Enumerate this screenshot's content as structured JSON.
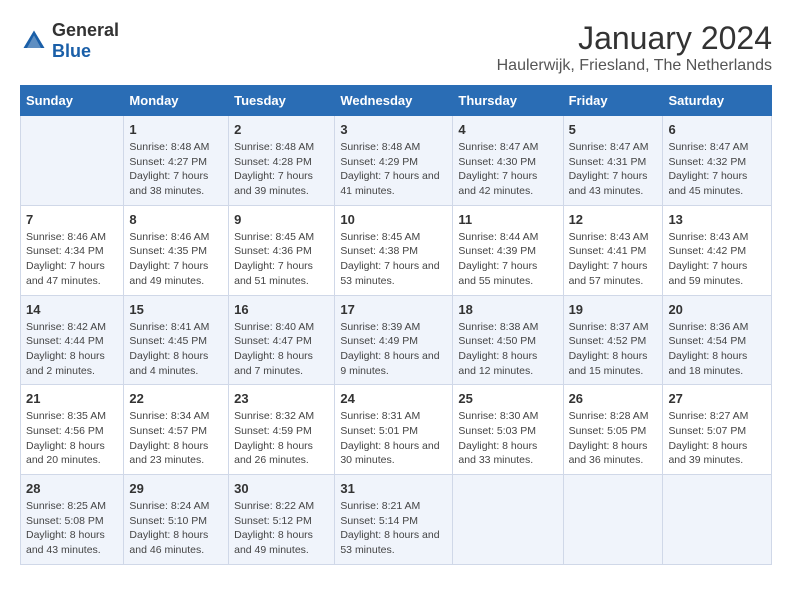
{
  "header": {
    "logo": {
      "text_general": "General",
      "text_blue": "Blue"
    },
    "title": "January 2024",
    "subtitle": "Haulerwijk, Friesland, The Netherlands"
  },
  "columns": [
    "Sunday",
    "Monday",
    "Tuesday",
    "Wednesday",
    "Thursday",
    "Friday",
    "Saturday"
  ],
  "weeks": [
    [
      {
        "day": "",
        "sunrise": "",
        "sunset": "",
        "daylight": ""
      },
      {
        "day": "1",
        "sunrise": "Sunrise: 8:48 AM",
        "sunset": "Sunset: 4:27 PM",
        "daylight": "Daylight: 7 hours and 38 minutes."
      },
      {
        "day": "2",
        "sunrise": "Sunrise: 8:48 AM",
        "sunset": "Sunset: 4:28 PM",
        "daylight": "Daylight: 7 hours and 39 minutes."
      },
      {
        "day": "3",
        "sunrise": "Sunrise: 8:48 AM",
        "sunset": "Sunset: 4:29 PM",
        "daylight": "Daylight: 7 hours and 41 minutes."
      },
      {
        "day": "4",
        "sunrise": "Sunrise: 8:47 AM",
        "sunset": "Sunset: 4:30 PM",
        "daylight": "Daylight: 7 hours and 42 minutes."
      },
      {
        "day": "5",
        "sunrise": "Sunrise: 8:47 AM",
        "sunset": "Sunset: 4:31 PM",
        "daylight": "Daylight: 7 hours and 43 minutes."
      },
      {
        "day": "6",
        "sunrise": "Sunrise: 8:47 AM",
        "sunset": "Sunset: 4:32 PM",
        "daylight": "Daylight: 7 hours and 45 minutes."
      }
    ],
    [
      {
        "day": "7",
        "sunrise": "Sunrise: 8:46 AM",
        "sunset": "Sunset: 4:34 PM",
        "daylight": "Daylight: 7 hours and 47 minutes."
      },
      {
        "day": "8",
        "sunrise": "Sunrise: 8:46 AM",
        "sunset": "Sunset: 4:35 PM",
        "daylight": "Daylight: 7 hours and 49 minutes."
      },
      {
        "day": "9",
        "sunrise": "Sunrise: 8:45 AM",
        "sunset": "Sunset: 4:36 PM",
        "daylight": "Daylight: 7 hours and 51 minutes."
      },
      {
        "day": "10",
        "sunrise": "Sunrise: 8:45 AM",
        "sunset": "Sunset: 4:38 PM",
        "daylight": "Daylight: 7 hours and 53 minutes."
      },
      {
        "day": "11",
        "sunrise": "Sunrise: 8:44 AM",
        "sunset": "Sunset: 4:39 PM",
        "daylight": "Daylight: 7 hours and 55 minutes."
      },
      {
        "day": "12",
        "sunrise": "Sunrise: 8:43 AM",
        "sunset": "Sunset: 4:41 PM",
        "daylight": "Daylight: 7 hours and 57 minutes."
      },
      {
        "day": "13",
        "sunrise": "Sunrise: 8:43 AM",
        "sunset": "Sunset: 4:42 PM",
        "daylight": "Daylight: 7 hours and 59 minutes."
      }
    ],
    [
      {
        "day": "14",
        "sunrise": "Sunrise: 8:42 AM",
        "sunset": "Sunset: 4:44 PM",
        "daylight": "Daylight: 8 hours and 2 minutes."
      },
      {
        "day": "15",
        "sunrise": "Sunrise: 8:41 AM",
        "sunset": "Sunset: 4:45 PM",
        "daylight": "Daylight: 8 hours and 4 minutes."
      },
      {
        "day": "16",
        "sunrise": "Sunrise: 8:40 AM",
        "sunset": "Sunset: 4:47 PM",
        "daylight": "Daylight: 8 hours and 7 minutes."
      },
      {
        "day": "17",
        "sunrise": "Sunrise: 8:39 AM",
        "sunset": "Sunset: 4:49 PM",
        "daylight": "Daylight: 8 hours and 9 minutes."
      },
      {
        "day": "18",
        "sunrise": "Sunrise: 8:38 AM",
        "sunset": "Sunset: 4:50 PM",
        "daylight": "Daylight: 8 hours and 12 minutes."
      },
      {
        "day": "19",
        "sunrise": "Sunrise: 8:37 AM",
        "sunset": "Sunset: 4:52 PM",
        "daylight": "Daylight: 8 hours and 15 minutes."
      },
      {
        "day": "20",
        "sunrise": "Sunrise: 8:36 AM",
        "sunset": "Sunset: 4:54 PM",
        "daylight": "Daylight: 8 hours and 18 minutes."
      }
    ],
    [
      {
        "day": "21",
        "sunrise": "Sunrise: 8:35 AM",
        "sunset": "Sunset: 4:56 PM",
        "daylight": "Daylight: 8 hours and 20 minutes."
      },
      {
        "day": "22",
        "sunrise": "Sunrise: 8:34 AM",
        "sunset": "Sunset: 4:57 PM",
        "daylight": "Daylight: 8 hours and 23 minutes."
      },
      {
        "day": "23",
        "sunrise": "Sunrise: 8:32 AM",
        "sunset": "Sunset: 4:59 PM",
        "daylight": "Daylight: 8 hours and 26 minutes."
      },
      {
        "day": "24",
        "sunrise": "Sunrise: 8:31 AM",
        "sunset": "Sunset: 5:01 PM",
        "daylight": "Daylight: 8 hours and 30 minutes."
      },
      {
        "day": "25",
        "sunrise": "Sunrise: 8:30 AM",
        "sunset": "Sunset: 5:03 PM",
        "daylight": "Daylight: 8 hours and 33 minutes."
      },
      {
        "day": "26",
        "sunrise": "Sunrise: 8:28 AM",
        "sunset": "Sunset: 5:05 PM",
        "daylight": "Daylight: 8 hours and 36 minutes."
      },
      {
        "day": "27",
        "sunrise": "Sunrise: 8:27 AM",
        "sunset": "Sunset: 5:07 PM",
        "daylight": "Daylight: 8 hours and 39 minutes."
      }
    ],
    [
      {
        "day": "28",
        "sunrise": "Sunrise: 8:25 AM",
        "sunset": "Sunset: 5:08 PM",
        "daylight": "Daylight: 8 hours and 43 minutes."
      },
      {
        "day": "29",
        "sunrise": "Sunrise: 8:24 AM",
        "sunset": "Sunset: 5:10 PM",
        "daylight": "Daylight: 8 hours and 46 minutes."
      },
      {
        "day": "30",
        "sunrise": "Sunrise: 8:22 AM",
        "sunset": "Sunset: 5:12 PM",
        "daylight": "Daylight: 8 hours and 49 minutes."
      },
      {
        "day": "31",
        "sunrise": "Sunrise: 8:21 AM",
        "sunset": "Sunset: 5:14 PM",
        "daylight": "Daylight: 8 hours and 53 minutes."
      },
      {
        "day": "",
        "sunrise": "",
        "sunset": "",
        "daylight": ""
      },
      {
        "day": "",
        "sunrise": "",
        "sunset": "",
        "daylight": ""
      },
      {
        "day": "",
        "sunrise": "",
        "sunset": "",
        "daylight": ""
      }
    ]
  ]
}
